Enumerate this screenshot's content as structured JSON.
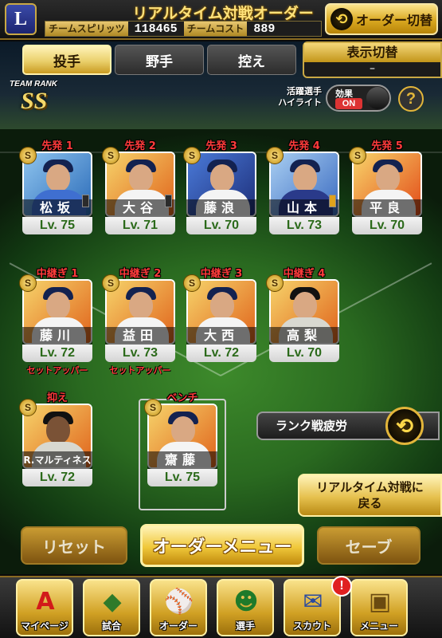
{
  "header": {
    "logo": "L",
    "title": "リアルタイム対戦オーダー",
    "spirit_label": "チームスピリッツ",
    "spirit_value": "118465",
    "cost_label": "チームコスト",
    "cost_value": "889",
    "order_switch": "オーダー切替"
  },
  "tabs": [
    {
      "label": "投手",
      "active": true
    },
    {
      "label": "野手",
      "active": false
    },
    {
      "label": "控え",
      "active": false
    }
  ],
  "display_switch": {
    "label": "表示切替",
    "value": "–"
  },
  "team_rank": {
    "label": "TEAM RANK",
    "value": "SS"
  },
  "highlight": {
    "label_line1": "活躍選手",
    "label_line2": "ハイライト",
    "effect_label": "効果",
    "effect_state": "ON"
  },
  "starters": [
    {
      "slot": "先発 1",
      "name": "松坂",
      "level": "Lv. 75",
      "badge": "S",
      "jersey": "#3f6fd0"
    },
    {
      "slot": "先発 2",
      "name": "大谷",
      "level": "Lv. 71",
      "badge": "S",
      "jersey": "#e8e8e8"
    },
    {
      "slot": "先発 3",
      "name": "藤浪",
      "level": "Lv. 70",
      "badge": "S",
      "jersey": "#e8e8e8"
    },
    {
      "slot": "先発 4",
      "name": "山本",
      "level": "Lv. 73",
      "badge": "S",
      "jersey": "#2a3a8a"
    },
    {
      "slot": "先発 5",
      "name": "平良",
      "level": "Lv. 70",
      "badge": "S",
      "jersey": "#e8e8e8"
    }
  ],
  "relievers": [
    {
      "slot": "中継ぎ 1",
      "name": "藤川",
      "level": "Lv. 72",
      "badge": "S",
      "note": "セットアッパー"
    },
    {
      "slot": "中継ぎ 2",
      "name": "益田",
      "level": "Lv. 73",
      "badge": "S",
      "note": "セットアッパー"
    },
    {
      "slot": "中継ぎ 3",
      "name": "大西",
      "level": "Lv. 72",
      "badge": "S",
      "note": ""
    },
    {
      "slot": "中継ぎ 4",
      "name": "高梨",
      "level": "Lv. 70",
      "badge": "S",
      "note": ""
    }
  ],
  "closer": {
    "slot": "抑え",
    "name": "R.マルティネス",
    "level": "Lv. 72",
    "badge": "S"
  },
  "bench": {
    "slot": "ベンチ",
    "name": "齋藤",
    "level": "Lv. 75",
    "badge": "S"
  },
  "rank_fatigue": "ランク戦疲労",
  "back_button": {
    "line1": "リアルタイム対戦に",
    "line2": "戻る"
  },
  "actions": {
    "reset": "リセット",
    "order_menu": "オーダーメニュー",
    "save": "セーブ"
  },
  "nav": [
    {
      "label": "マイページ",
      "icon": "A"
    },
    {
      "label": "試合",
      "icon": "◆"
    },
    {
      "label": "オーダー",
      "icon": "⚾"
    },
    {
      "label": "選手",
      "icon": "☻"
    },
    {
      "label": "スカウト",
      "icon": "✉"
    },
    {
      "label": "メニュー",
      "icon": "▣"
    }
  ],
  "notification_badge": "!"
}
